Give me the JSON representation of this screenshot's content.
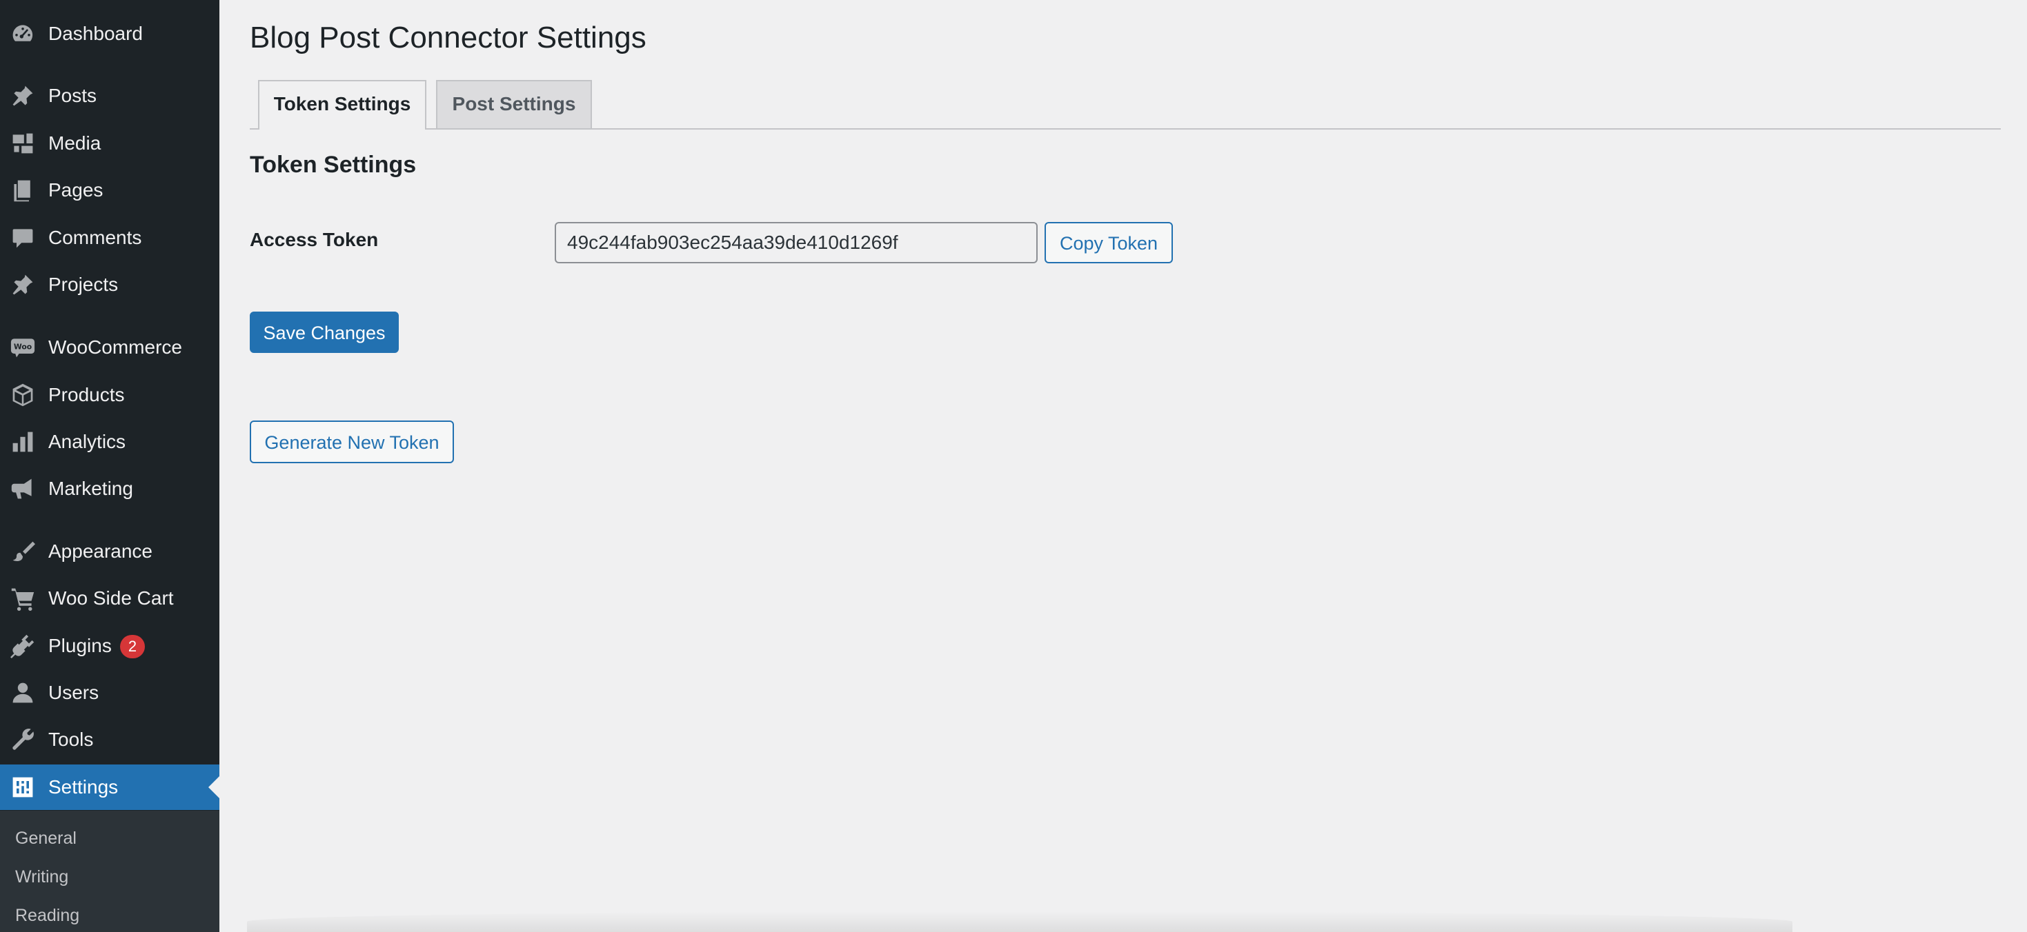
{
  "sidebar": {
    "items": [
      {
        "label": "Dashboard",
        "icon": "dashboard-icon"
      },
      {
        "label": "Posts",
        "icon": "pin-icon"
      },
      {
        "label": "Media",
        "icon": "media-icon"
      },
      {
        "label": "Pages",
        "icon": "pages-icon"
      },
      {
        "label": "Comments",
        "icon": "comment-icon"
      },
      {
        "label": "Projects",
        "icon": "pin-icon"
      },
      {
        "label": "WooCommerce",
        "icon": "woo-icon",
        "icon_text": "Woo"
      },
      {
        "label": "Products",
        "icon": "box-icon"
      },
      {
        "label": "Analytics",
        "icon": "bar-chart-icon"
      },
      {
        "label": "Marketing",
        "icon": "megaphone-icon"
      },
      {
        "label": "Appearance",
        "icon": "paintbrush-icon"
      },
      {
        "label": "Woo Side Cart",
        "icon": "cart-icon"
      },
      {
        "label": "Plugins",
        "icon": "plug-icon",
        "badge": "2"
      },
      {
        "label": "Users",
        "icon": "user-icon"
      },
      {
        "label": "Tools",
        "icon": "wrench-icon"
      },
      {
        "label": "Settings",
        "icon": "settings-sliders-icon",
        "active": true
      }
    ],
    "submenu": [
      {
        "label": "General"
      },
      {
        "label": "Writing"
      },
      {
        "label": "Reading"
      }
    ]
  },
  "main": {
    "title": "Blog Post Connector Settings",
    "tabs": [
      {
        "label": "Token Settings",
        "active": true
      },
      {
        "label": "Post Settings",
        "active": false
      }
    ],
    "section_heading": "Token Settings",
    "access_token_label": "Access Token",
    "access_token_value": "49c244fab903ec254aa39de410d1269f",
    "copy_token_label": "Copy Token",
    "save_changes_label": "Save Changes",
    "generate_token_label": "Generate New Token"
  },
  "colors": {
    "sidebar_bg": "#1d2327",
    "submenu_bg": "#2c3338",
    "accent": "#2271b1",
    "badge": "#d63638",
    "page_bg": "#f0f0f1"
  }
}
